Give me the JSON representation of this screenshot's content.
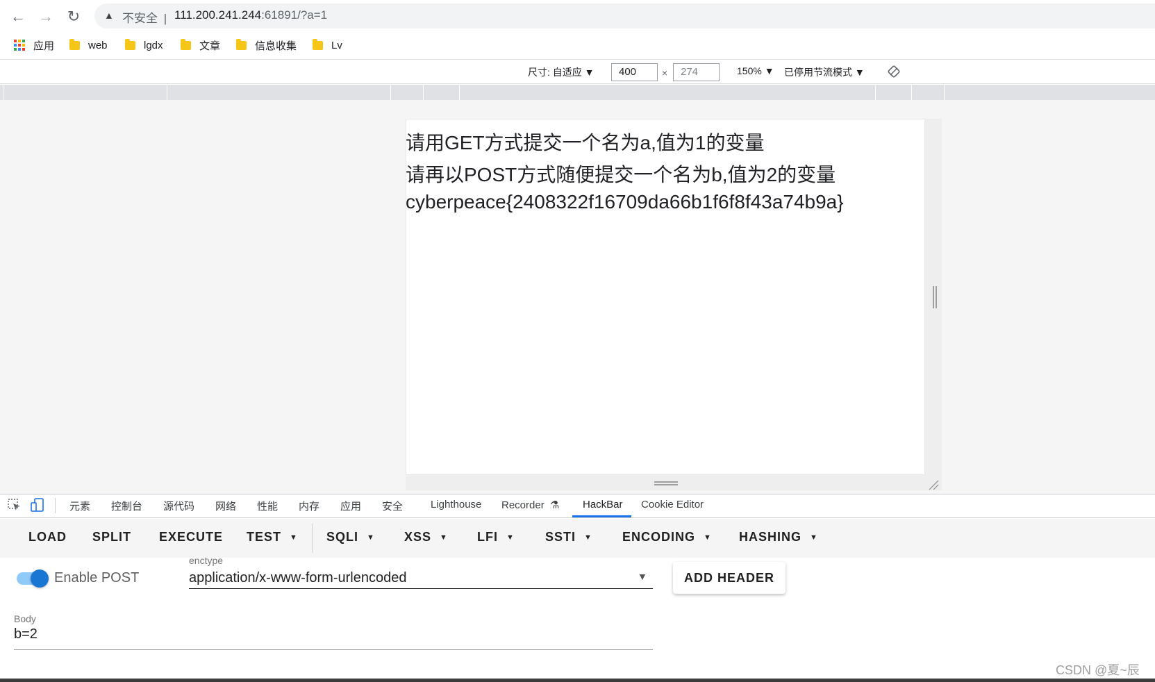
{
  "browser": {
    "warning_label": "不安全",
    "url_host": "111.200.241.244",
    "url_rest": ":61891/?a=1",
    "separator": "|"
  },
  "bookmarks": [
    {
      "label": "应用"
    },
    {
      "label": "web"
    },
    {
      "label": "lgdx"
    },
    {
      "label": "文章"
    },
    {
      "label": "信息收集"
    },
    {
      "label": "Lv"
    }
  ],
  "device_toolbar": {
    "size_label": "尺寸: 自适应 ▼",
    "width": "400",
    "times": "×",
    "height": "274",
    "zoom": "150% ▼",
    "throttle": "已停用节流模式 ▼"
  },
  "page": {
    "line1": "请用GET方式提交一个名为a,值为1的变量",
    "line2": "请再以POST方式随便提交一个名为b,值为2的变量",
    "line3": "cyberpeace{2408322f16709da66b1f6f8f43a74b9a}"
  },
  "devtools": {
    "tabs": [
      "元素",
      "控制台",
      "源代码",
      "网络",
      "性能",
      "内存",
      "应用",
      "安全",
      "Lighthouse",
      "Recorder",
      "HackBar",
      "Cookie Editor"
    ],
    "active_tab": "HackBar"
  },
  "hackbar": {
    "buttons": {
      "load": "LOAD",
      "split": "SPLIT",
      "execute": "EXECUTE",
      "test": "TEST",
      "sqli": "SQLI",
      "xss": "XSS",
      "lfi": "LFI",
      "ssti": "SSTI",
      "encoding": "ENCODING",
      "hashing": "HASHING"
    },
    "enable_post_label": "Enable POST",
    "enable_post_on": true,
    "enctype_label": "enctype",
    "enctype_value": "application/x-www-form-urlencoded",
    "add_header": "ADD HEADER",
    "body_label": "Body",
    "body_value": "b=2"
  },
  "watermark": "CSDN @夏~辰",
  "colors": {
    "accent": "#1a73e8",
    "toggle_knob": "#1976d2",
    "toggle_track": "#90caf9",
    "folder": "#f5c518"
  }
}
